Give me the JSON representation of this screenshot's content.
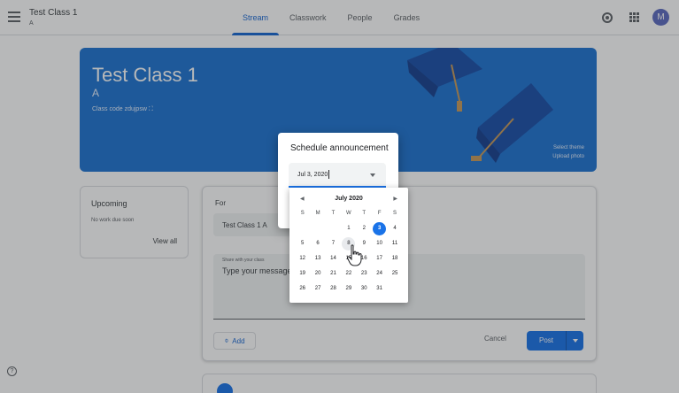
{
  "header": {
    "class_title": "Test Class 1",
    "class_section": "A",
    "tabs": [
      {
        "label": "Stream",
        "active": true
      },
      {
        "label": "Classwork",
        "active": false
      },
      {
        "label": "People",
        "active": false
      },
      {
        "label": "Grades",
        "active": false
      }
    ],
    "avatar_letter": "M"
  },
  "banner": {
    "title": "Test Class 1",
    "section": "A",
    "class_code_label": "Class code",
    "class_code": "zdujpsw",
    "select_theme": "Select theme",
    "upload_photo": "Upload photo"
  },
  "upcoming": {
    "title": "Upcoming",
    "note": "No work due soon",
    "view_all": "View all"
  },
  "announce": {
    "for_label": "For",
    "for_value": "Test Class 1 A",
    "share_label": "Share with your class",
    "message_placeholder": "Type your message",
    "add_label": "Add",
    "cancel_label": "Cancel",
    "post_label": "Post"
  },
  "schedule_dialog": {
    "title": "Schedule announcement",
    "date_value": "Jul 3, 2020"
  },
  "calendar": {
    "month_label": "July 2020",
    "weekdays": [
      "S",
      "M",
      "T",
      "W",
      "T",
      "F",
      "S"
    ],
    "weeks": [
      [
        "",
        "",
        "",
        "1",
        "2",
        "3",
        "4"
      ],
      [
        "5",
        "6",
        "7",
        "8",
        "9",
        "10",
        "11"
      ],
      [
        "12",
        "13",
        "14",
        "15",
        "16",
        "17",
        "18"
      ],
      [
        "19",
        "20",
        "21",
        "22",
        "23",
        "24",
        "25"
      ],
      [
        "26",
        "27",
        "28",
        "29",
        "30",
        "31",
        ""
      ]
    ],
    "selected_day": "3",
    "hover_day": "8"
  },
  "colors": {
    "accent": "#1a73e8",
    "banner": "#1e74d1"
  }
}
